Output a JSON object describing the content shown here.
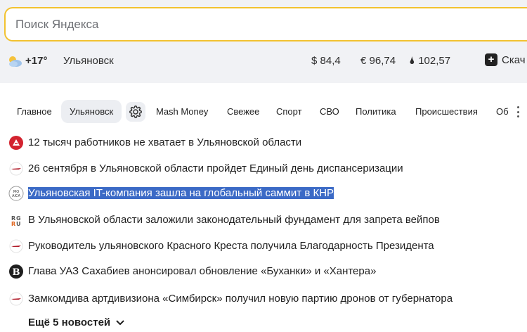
{
  "search": {
    "placeholder": "Поиск Яндекса"
  },
  "info": {
    "weather_icon": "partly-cloudy-icon",
    "temperature": "+17°",
    "city": "Ульяновск",
    "usd": "$ 84,4",
    "eur": "€ 96,74",
    "oil": "102,57",
    "more_label": "Скач"
  },
  "tabs": [
    {
      "label": "Главное"
    },
    {
      "label": "Ульяновск"
    },
    {
      "label": "Mash Money"
    },
    {
      "label": "Свежее"
    },
    {
      "label": "Спорт"
    },
    {
      "label": "СВО"
    },
    {
      "label": "Политика"
    },
    {
      "label": "Происшествия"
    },
    {
      "label": "Об"
    }
  ],
  "news": [
    {
      "text": "12 тысяч работников не хватает в Ульяновской области",
      "icon": "red-circle-source-icon"
    },
    {
      "text": "26 сентября в Ульяновской области пройдет Единый день диспансеризации",
      "icon": "source-icon"
    },
    {
      "text": "Ульяновская IT-компания зашла на глобальный саммит в КНР",
      "icon": "mosaica-source-icon"
    },
    {
      "text": "В Ульяновской области заложили законодательный фундамент для запрета вейпов",
      "icon": "rg-source-icon"
    },
    {
      "text": "Руководитель ульяновского Красного Креста получила Благодарность Президента",
      "icon": "source-icon"
    },
    {
      "text": "Глава УАЗ Сахабиев анонсировал обновление «Буханки» и «Хантера»",
      "icon": "b-source-icon"
    },
    {
      "text": "Замкомдива артдивизиона «Симбирск» получил новую партию дронов от губернатора",
      "icon": "source-icon"
    }
  ],
  "more_news": "Ещё 5 новостей",
  "colors": {
    "search_border": "#f2c230",
    "selection": "#3b6ac6",
    "band": "#f1f2f5"
  }
}
